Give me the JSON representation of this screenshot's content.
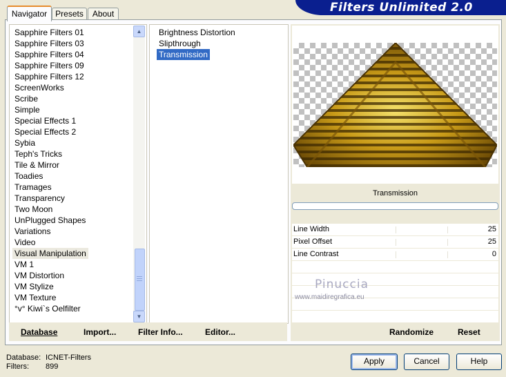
{
  "window": {
    "title": "Filters Unlimited 2.0"
  },
  "tabs": [
    {
      "label": "Navigator",
      "active": true
    },
    {
      "label": "Presets",
      "active": false
    },
    {
      "label": "About",
      "active": false
    }
  ],
  "categories": [
    "Sapphire Filters 01",
    "Sapphire Filters 03",
    "Sapphire Filters 04",
    "Sapphire Filters 09",
    "Sapphire Filters 12",
    "ScreenWorks",
    "Scribe",
    "Simple",
    "Special Effects 1",
    "Special Effects 2",
    "Sybia",
    "Teph's Tricks",
    "Tile & Mirror",
    "Toadies",
    "Tramages",
    "Transparency",
    "Two Moon",
    "UnPlugged Shapes",
    "Variations",
    "Video",
    "Visual Manipulation",
    "VM 1",
    "VM Distortion",
    "VM Stylize",
    "VM Texture",
    "°v° Kiwi`s Oelfilter"
  ],
  "selected_category": "Visual Manipulation",
  "filters": [
    "Brightness Distortion",
    "Slipthrough",
    "Transmission"
  ],
  "selected_filter": "Transmission",
  "left_buttons": {
    "database": "Database",
    "import": "Import...",
    "filter_info": "Filter Info...",
    "editor": "Editor..."
  },
  "preview": {
    "filter_name": "Transmission"
  },
  "parameters": [
    {
      "label": "Line Width",
      "value": "25"
    },
    {
      "label": "Pixel Offset",
      "value": "25"
    },
    {
      "label": "Line Contrast",
      "value": "0"
    }
  ],
  "watermark": {
    "name": "Pinuccia",
    "url": "www.maidiregrafica.eu"
  },
  "right_buttons": {
    "randomize": "Randomize",
    "reset": "Reset"
  },
  "status": {
    "database_label": "Database:",
    "database_value": "ICNET-Filters",
    "filters_label": "Filters:",
    "filters_value": "899"
  },
  "dialog_buttons": {
    "apply": "Apply",
    "cancel": "Cancel",
    "help": "Help"
  },
  "colors": {
    "selection": "#316ac5",
    "banner": "#0a1f8f",
    "face": "#ece9d8",
    "pyramid": "#d9b22a"
  }
}
